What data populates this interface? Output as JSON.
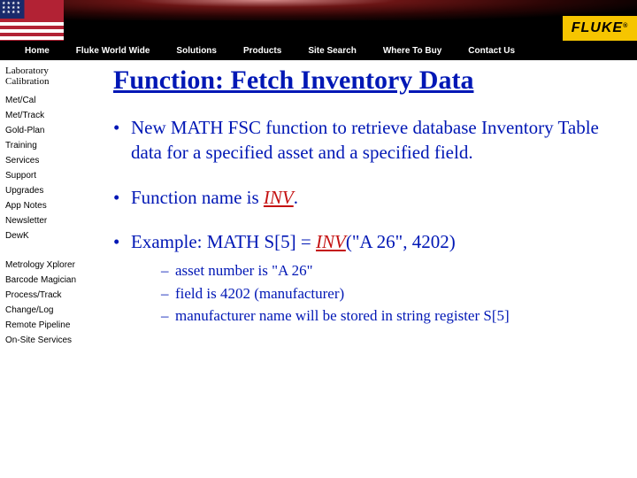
{
  "brand": "FLUKE",
  "nav": [
    "Home",
    "Fluke World Wide",
    "Solutions",
    "Products",
    "Site Search",
    "Where To Buy",
    "Contact Us"
  ],
  "sidebar": {
    "heading": "Laboratory Calibration",
    "group1": [
      "Met/Cal",
      "Met/Track",
      "Gold-Plan",
      "Training",
      "Services",
      "Support",
      "Upgrades",
      "App Notes",
      "Newsletter",
      "DewK"
    ],
    "group2": [
      "Metrology Xplorer",
      "Barcode Magician",
      "Process/Track",
      "Change/Log",
      "Remote Pipeline",
      "On-Site Services"
    ]
  },
  "content": {
    "title": "Function: Fetch Inventory Data",
    "b1": "New MATH FSC function to retrieve database Inventory Table data for a specified asset and a specified field.",
    "b2_pre": "Function name is ",
    "b2_fn": "INV",
    "b2_post": ".",
    "b3_pre": "Example:   MATH  S[5] = ",
    "b3_fn": "INV",
    "b3_post": "(\"A 26\", 4202)",
    "subs": [
      "asset number is \"A 26\"",
      "field is 4202 (manufacturer)",
      "manufacturer name will be stored in string register S[5]"
    ]
  }
}
